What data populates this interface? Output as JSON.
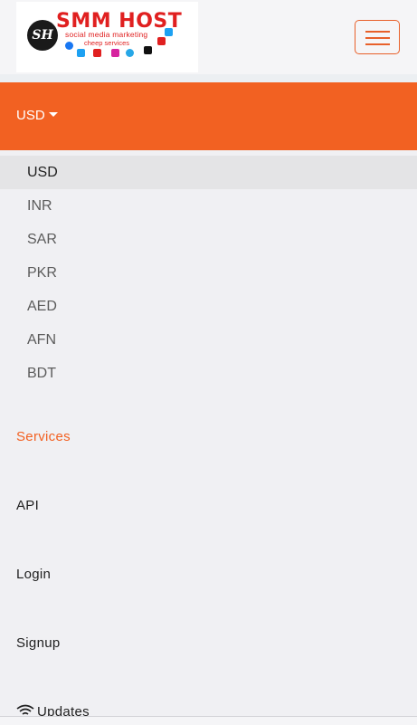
{
  "header": {
    "logo": {
      "badge": "SH",
      "title": "SMM HOST",
      "tagline": "social media marketing",
      "subtitle": "cheep services"
    },
    "menu_button_icon": "hamburger-icon"
  },
  "currency": {
    "selected": "USD",
    "options": [
      "USD",
      "INR",
      "SAR",
      "PKR",
      "AED",
      "AFN",
      "BDT"
    ]
  },
  "nav": {
    "services": "Services",
    "api": "API",
    "login": "Login",
    "signup": "Signup",
    "updates": "Updates"
  },
  "colors": {
    "accent": "#f26122",
    "logo_red": "#e02020"
  }
}
